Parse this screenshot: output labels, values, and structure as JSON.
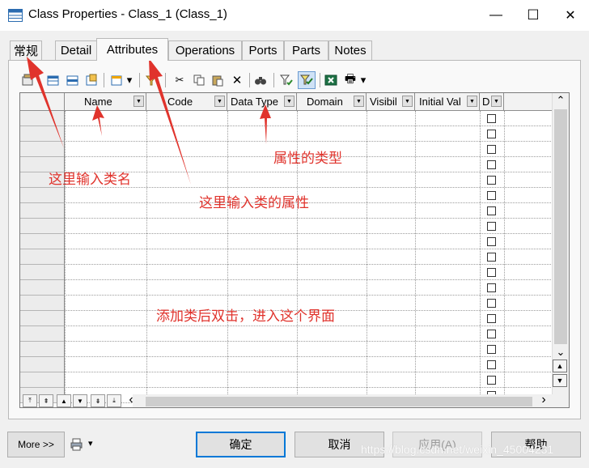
{
  "window": {
    "title": "Class Properties - Class_1 (Class_1)",
    "minimize": "—",
    "maximize": "☐",
    "close": "✕"
  },
  "tabs": [
    "常规",
    "Detail",
    "Attributes",
    "Operations",
    "Ports",
    "Parts",
    "Notes"
  ],
  "active_tab": "Attributes",
  "toolbar": {
    "icons": [
      "properties-icon",
      "add-row-icon",
      "insert-row-icon",
      "add-attributes-icon",
      "customize-columns-icon",
      "filter-icon",
      "cut-icon",
      "copy-icon",
      "paste-icon",
      "delete-icon",
      "find-icon",
      "filter-settings-icon",
      "enable-filter-icon",
      "excel-export-icon",
      "print-icon"
    ],
    "glyphs": {
      "cut": "✂",
      "delete": "✕",
      "find": "🔍",
      "print": "🖶",
      "dropdown": "▾"
    }
  },
  "grid": {
    "columns": [
      "Name",
      "Code",
      "Data Type",
      "Domain",
      "Visibil",
      "Initial Val",
      "D"
    ],
    "row_count": 19,
    "last_column_checkbox": true
  },
  "navigation": {
    "buttons": [
      "move-to-top",
      "move-up-page",
      "move-up",
      "move-down",
      "move-down-page",
      "move-to-bottom"
    ],
    "glyphs": [
      "⤒",
      "⇞",
      "▲",
      "▼",
      "⇟",
      "⤓"
    ],
    "scroll_left": "‹",
    "scroll_right": "›",
    "scroll_up": "⌃",
    "scroll_down": "⌄"
  },
  "annotations": {
    "class_name": "这里输入类名",
    "attribute_type": "属性的类型",
    "attributes": "这里输入类的属性",
    "double_click": "添加类后双击，进入这个界面"
  },
  "buttons": {
    "more": "More >>",
    "ok": "确定",
    "cancel": "取消",
    "apply": "应用(A)",
    "help": "帮助"
  },
  "watermark": "https://blog.csdn.net/weixin_45004231",
  "colors": {
    "annotation": "#e0332c",
    "focus": "#0078d7"
  }
}
